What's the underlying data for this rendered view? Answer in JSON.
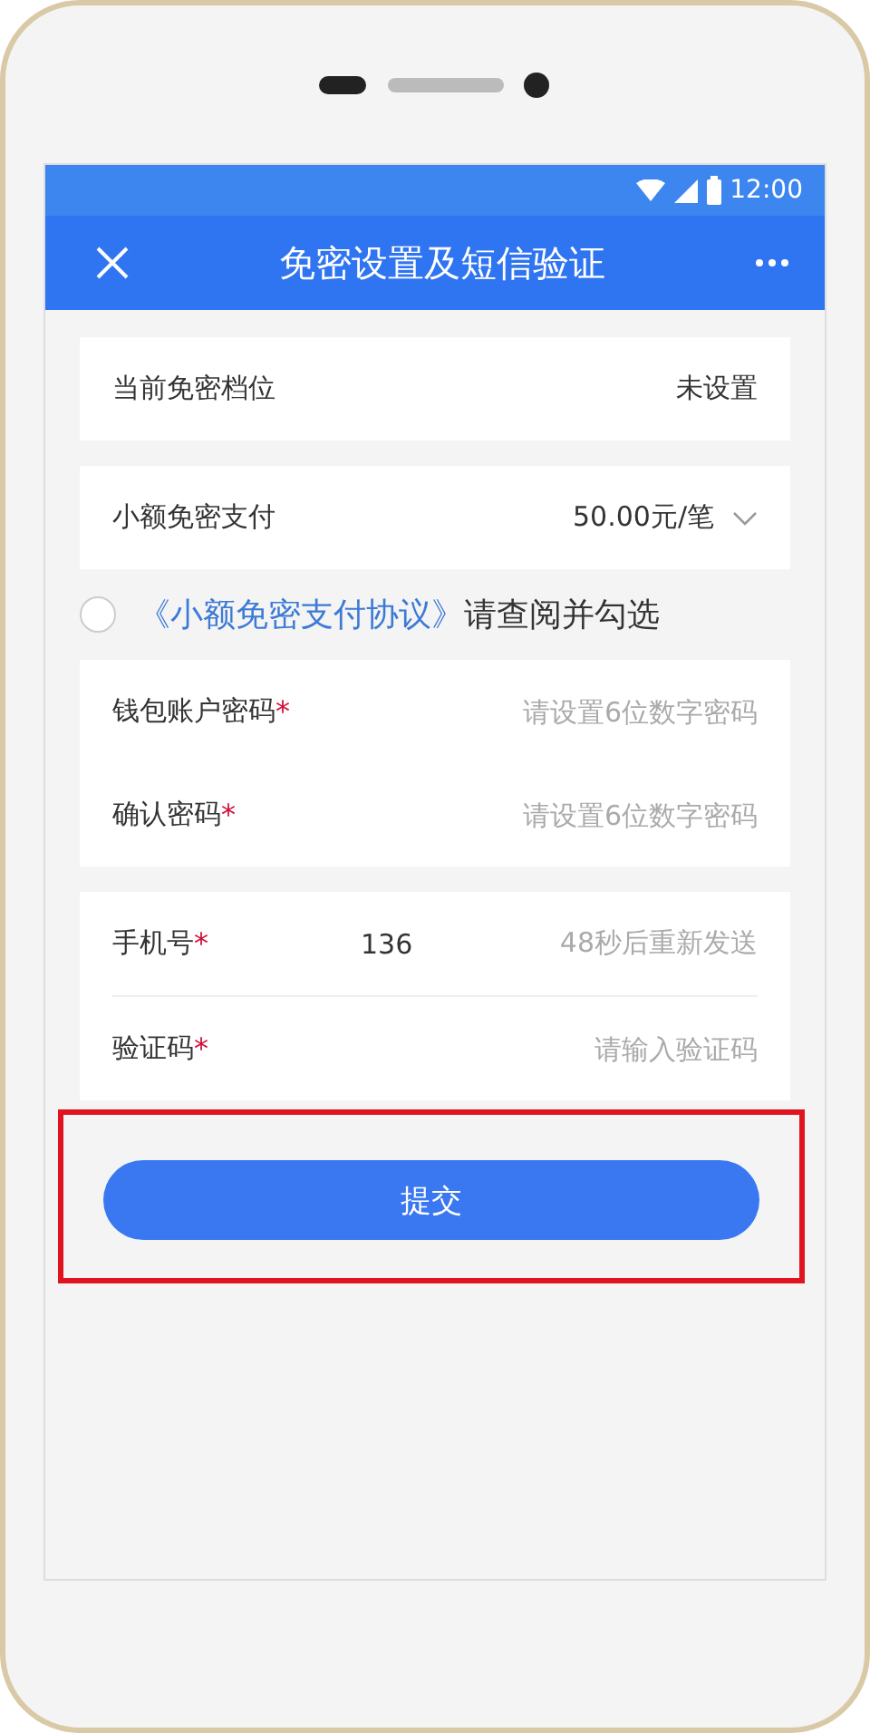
{
  "status_bar": {
    "time": "12:00"
  },
  "app_bar": {
    "title": "免密设置及短信验证"
  },
  "cards": [
    {
      "rows": [
        {
          "kind": "text",
          "label": "当前免密档位",
          "value": "未设置"
        }
      ]
    },
    {
      "rows": [
        {
          "kind": "dropdown",
          "label": "小额免密支付",
          "value": "50.00元/笔"
        }
      ]
    }
  ],
  "agreement": {
    "checked": false,
    "link": "《小额免密支付协议》",
    "text": "请查阅并勾选"
  },
  "form_cards": [
    {
      "dividers": false,
      "rows": [
        {
          "kind": "input",
          "label": "钱包账户密码",
          "required_mark": "*",
          "placeholder": "请设置6位数字密码"
        },
        {
          "kind": "input",
          "label": "确认密码",
          "required_mark": "*",
          "placeholder": "请设置6位数字密码"
        }
      ]
    },
    {
      "dividers": true,
      "rows": [
        {
          "kind": "input",
          "label": "手机号",
          "required_mark": "*",
          "value": "136",
          "action": "48秒后重新发送"
        },
        {
          "kind": "input",
          "label": "验证码",
          "required_mark": "*",
          "placeholder": "请输入验证码"
        }
      ]
    }
  ],
  "submit": {
    "label": "提交",
    "highlighted": true
  }
}
